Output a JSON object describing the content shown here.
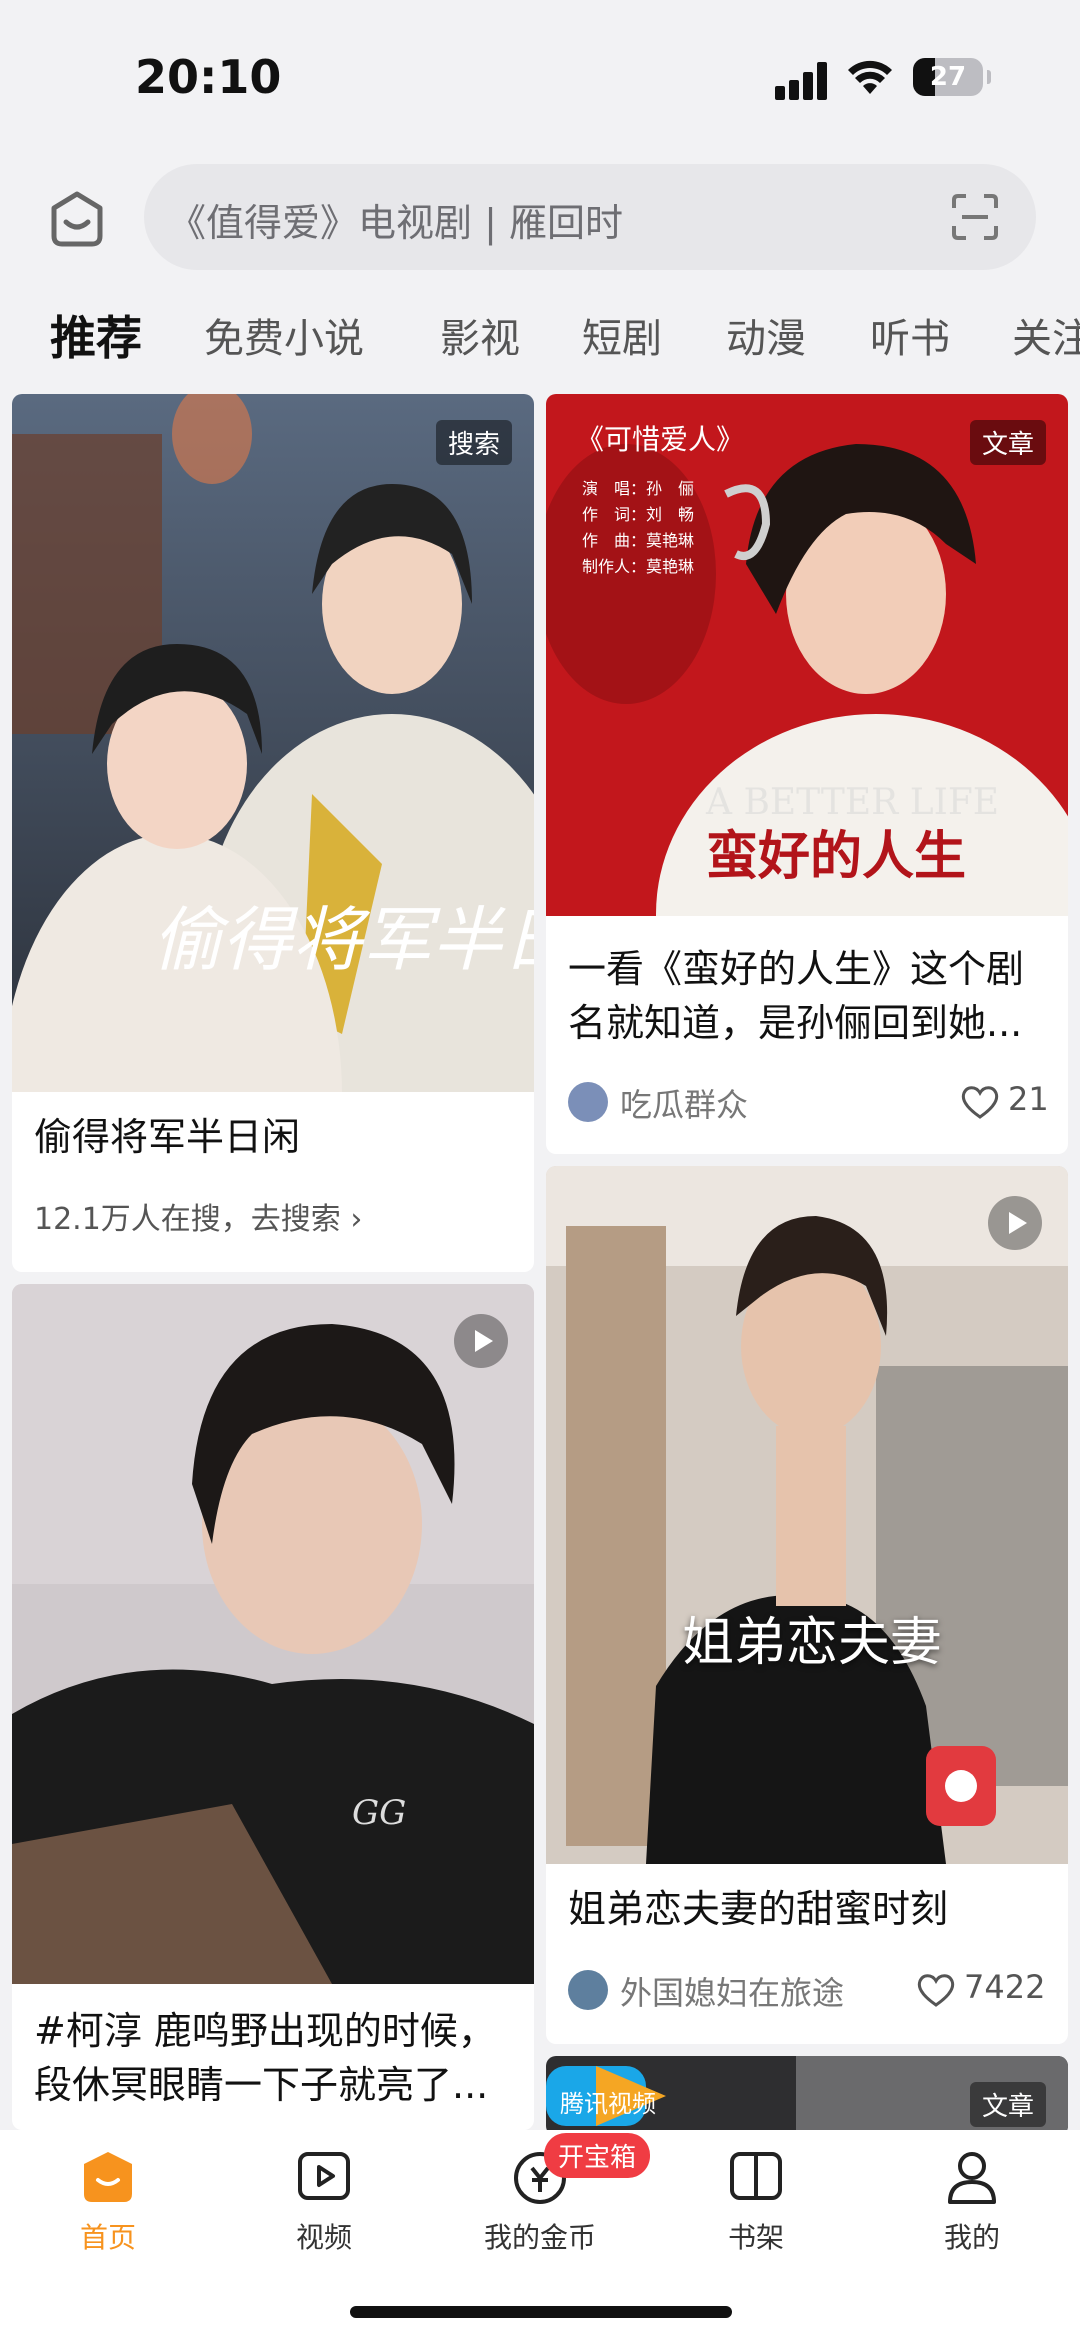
{
  "status": {
    "time": "20:10",
    "battery": "27"
  },
  "search": {
    "placeholder": "《值得爱》电视剧 | 雁回时"
  },
  "tabs": [
    "推荐",
    "免费小说",
    "影视",
    "短剧",
    "动漫",
    "听书",
    "关注"
  ],
  "cards": [
    {
      "title": "偷得将军半日闲",
      "badge": "搜索",
      "meta": "12.1万人在搜，去搜索 ›",
      "image_caption": "偷得将军半日闲"
    },
    {
      "title_line1": "一看《蛮好的人生》这个剧",
      "title_line2": "名就知道，是孙俪回到她...",
      "badge": "文章",
      "author": "吃瓜群众",
      "likes": "21",
      "poster_title": "《可惜爱人》",
      "poster_credits": [
        "演　唱：孙　俪",
        "作　词：刘　畅",
        "作　曲：莫艳琳",
        "制作人：莫艳琳"
      ],
      "poster_logo": "蛮好的人生",
      "poster_en": "A BETTER LIFE"
    },
    {
      "title_line1": "#柯淳 鹿鸣野出现的时候，",
      "title_line2": "段休冥眼睛一下子就亮了..."
    },
    {
      "title": "姐弟恋夫妻的甜蜜时刻",
      "overlay": "姐弟恋夫妻",
      "author": "外国媳妇在旅途",
      "likes": "7422"
    },
    {
      "badge": "文章",
      "brand": "腾讯视频"
    }
  ],
  "nav": [
    {
      "label": "首页",
      "icon": "home-icon"
    },
    {
      "label": "视频",
      "icon": "video-icon"
    },
    {
      "label": "我的金币",
      "icon": "coin-icon"
    },
    {
      "label": "书架",
      "icon": "bookshelf-icon"
    },
    {
      "label": "我的",
      "icon": "profile-icon"
    }
  ],
  "nav_pill": "开宝箱",
  "colors": {
    "accent": "#f7931e",
    "pill": "#f03c43"
  }
}
